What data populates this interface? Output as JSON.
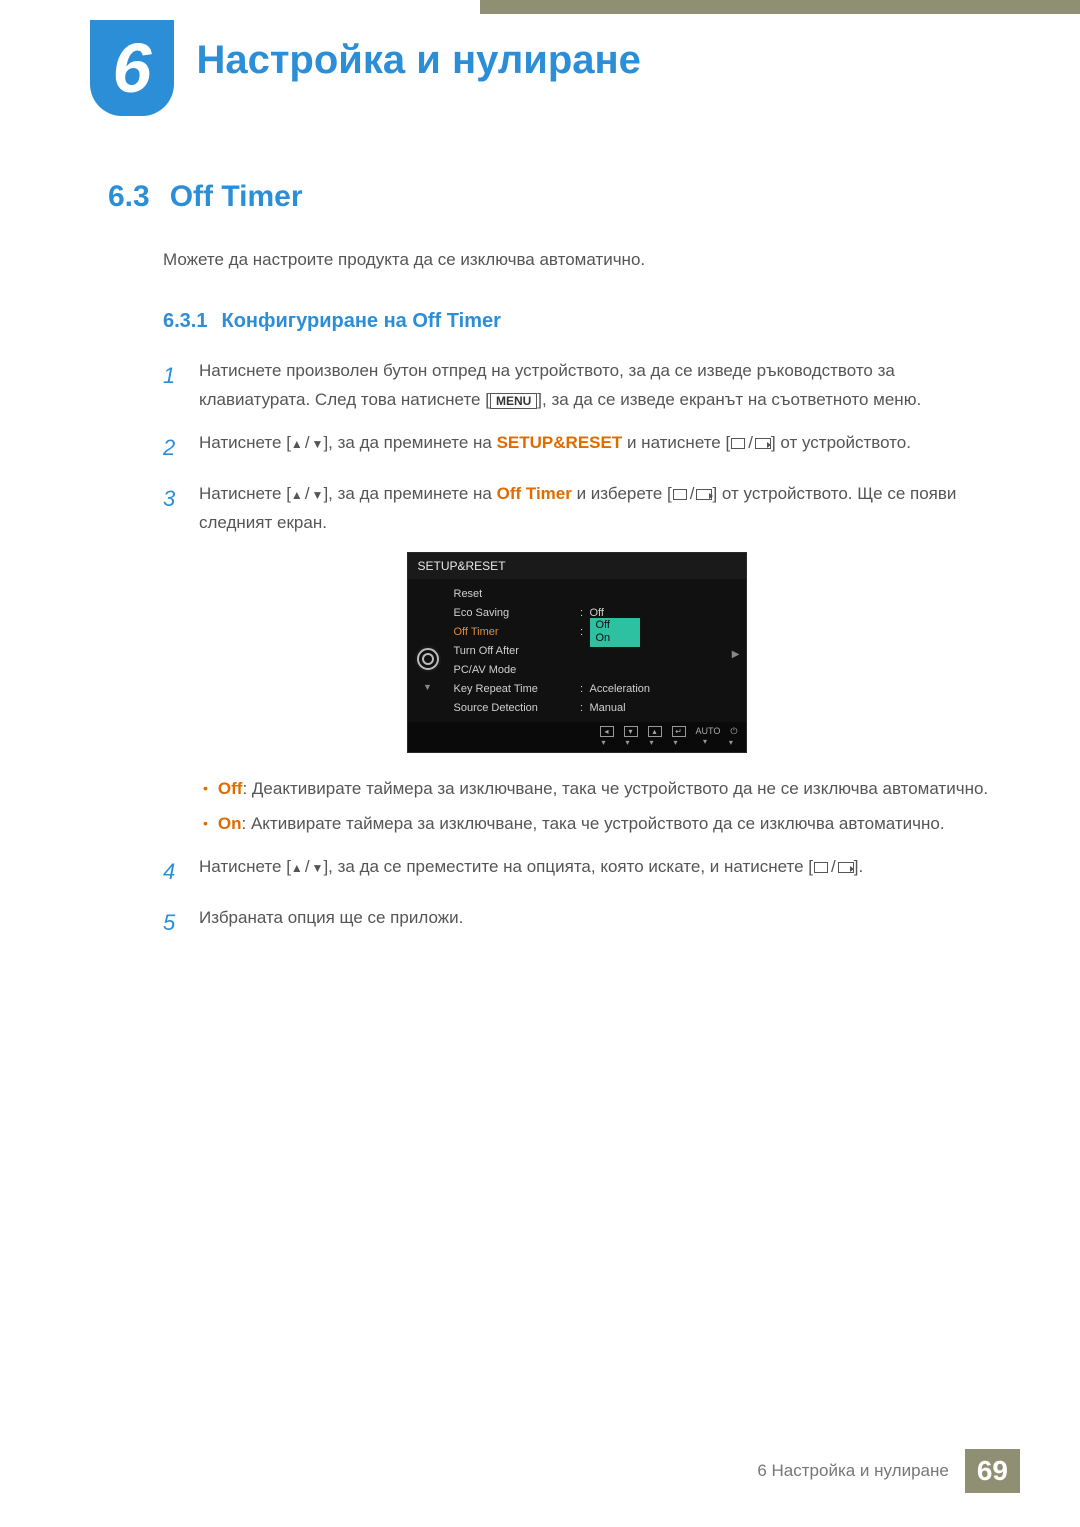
{
  "chapter": {
    "number": "6",
    "title": "Настройка и нулиране"
  },
  "section": {
    "number": "6.3",
    "title": "Off Timer"
  },
  "intro": "Можете да настроите продукта да се изключва автоматично.",
  "subsection": {
    "number": "6.3.1",
    "title": "Конфигуриране на Off Timer"
  },
  "steps": {
    "s1": {
      "num": "1",
      "pre": "Натиснете произволен бутон отпред на устройството, за да се изведе ръководството за клавиатурата. След това натиснете [",
      "menu": "MENU",
      "post": "], за да се изведе екранът на съответното меню."
    },
    "s2": {
      "num": "2",
      "pre": "Натиснете [",
      "mid1": "], за да преминете на ",
      "hl": "SETUP&RESET",
      "mid2": " и натиснете [",
      "post": "] от устройството."
    },
    "s3": {
      "num": "3",
      "pre": "Натиснете [",
      "mid1": "], за да преминете на ",
      "hl": "Off Timer",
      "mid2": " и изберете [",
      "post": "] от устройството. Ще се появи следният екран."
    },
    "s4": {
      "num": "4",
      "pre": "Натиснете [",
      "mid": "], за да се преместите на опцията, която искате, и натиснете [",
      "post": "]."
    },
    "s5": {
      "num": "5",
      "text": "Избраната опция ще се приложи."
    }
  },
  "bullets": {
    "off": {
      "hl": "Off",
      "text": ": Деактивирате таймера за изключване, така че устройството да не се изключва автоматично."
    },
    "on": {
      "hl": "On",
      "text": ": Активирате таймера за изключване, така че устройството да се изключва автоматично."
    }
  },
  "osd": {
    "title": "SETUP&RESET",
    "rows": {
      "reset": {
        "label": "Reset",
        "value": ""
      },
      "eco": {
        "label": "Eco Saving",
        "value": "Off"
      },
      "off": {
        "label": "Off Timer",
        "opt1": "Off",
        "opt2": "On"
      },
      "turnoff": {
        "label": "Turn Off After",
        "value": ""
      },
      "pcav": {
        "label": "PC/AV Mode",
        "value": ""
      },
      "key": {
        "label": "Key Repeat Time",
        "value": "Acceleration"
      },
      "src": {
        "label": "Source Detection",
        "value": "Manual"
      }
    },
    "footer": {
      "auto": "AUTO"
    }
  },
  "footer": {
    "text": "6 Настройка и нулиране",
    "page": "69"
  }
}
